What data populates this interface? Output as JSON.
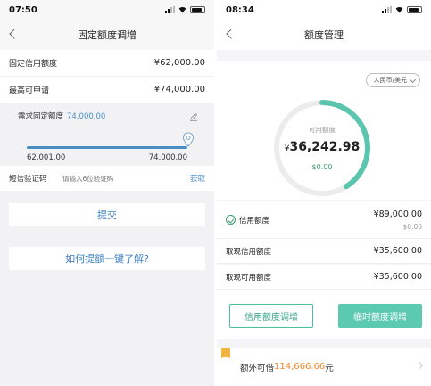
{
  "left": {
    "status_time": "07:50",
    "title": "固定额度调增",
    "rows": [
      {
        "label": "固定信用额度",
        "value": "¥62,000.00"
      },
      {
        "label": "最高可申请",
        "value": "¥74,000.00"
      }
    ],
    "slider": {
      "label": "需求固定额度",
      "current": "74,000.00",
      "min_label": "62,001.00",
      "max_label": "74,000.00",
      "fraction": 1.0
    },
    "sms": {
      "label": "短信验证码",
      "placeholder": "请输入6位验证码",
      "get_label": "获取"
    },
    "submit_label": "提交",
    "help_label": "如何提额一键了解?"
  },
  "right": {
    "status_time": "08:34",
    "title": "额度管理",
    "currency_label": "人民币/美元",
    "gauge": {
      "label": "可用额度",
      "currency_symbol": "¥",
      "value": "36,242.98",
      "sub_value": "$0.00",
      "fraction": 0.41,
      "color": "#5bc6ad"
    },
    "credit": {
      "label": "信用额度",
      "value": "¥89,000.00",
      "sub_value": "$0.00"
    },
    "rows": [
      {
        "label": "取现信用额度",
        "value": "¥35,600.00"
      },
      {
        "label": "取现可用额度",
        "value": "¥35,600.00"
      }
    ],
    "btn_credit_adjust": "信用额度调增",
    "btn_temp_adjust": "临时额度调增",
    "extra": {
      "prefix": "额外可借",
      "amount": "114,666.66",
      "suffix": "元"
    }
  }
}
